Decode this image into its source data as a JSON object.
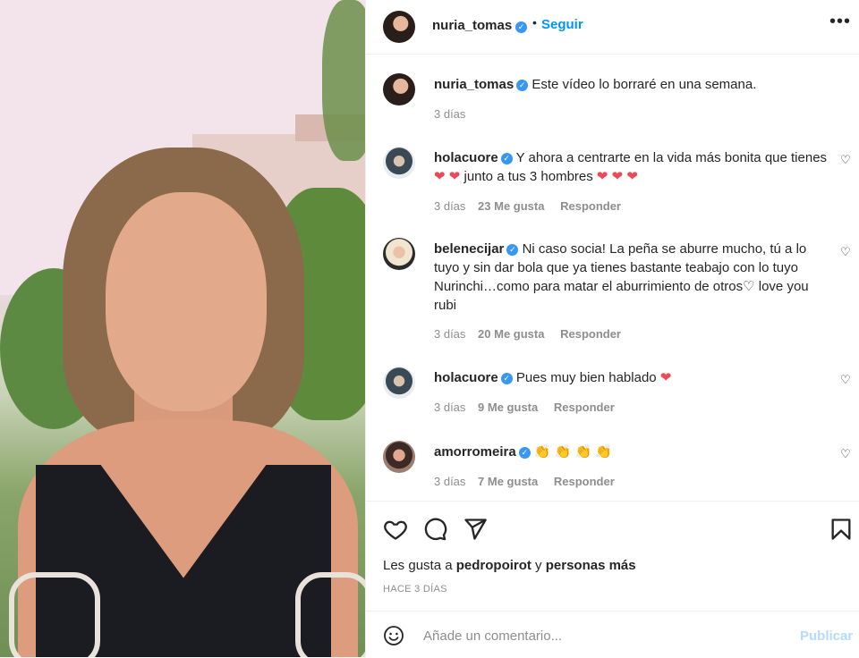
{
  "header": {
    "username": "nuria_tomas",
    "separator": "•",
    "follow_label": "Seguir",
    "more_icon": "more-icon"
  },
  "caption": {
    "username": "nuria_tomas",
    "text": "Este vídeo lo borraré en una semana.",
    "time": "3 días"
  },
  "comments": [
    {
      "username": "holacuore",
      "text": "Y ahora a centrarte en la vida más bonita que tienes ❤️ ❤️ junto a tus 3 hombres ❤️ ❤️ ❤️",
      "time": "3 días",
      "likes": "23 Me gusta",
      "reply": "Responder"
    },
    {
      "username": "belenecijar",
      "text": "Ni caso socia! La peña se aburre mucho, tú a lo tuyo y sin dar bola que ya tienes bastante teabajo con lo tuyo Nurinchi…como para matar el aburrimiento de otros♡ love you rubi",
      "time": "3 días",
      "likes": "20 Me gusta",
      "reply": "Responder"
    },
    {
      "username": "holacuore",
      "text": "Pues muy bien hablado ❤️",
      "time": "3 días",
      "likes": "9 Me gusta",
      "reply": "Responder"
    },
    {
      "username": "amorromeira",
      "text": "👏 👏 👏 👏",
      "time": "3 días",
      "likes": "7 Me gusta",
      "reply": "Responder"
    }
  ],
  "likes": {
    "prefix": "Les gusta a ",
    "user": "pedropoirot",
    "middle": " y ",
    "others": "personas más"
  },
  "timestamp": "HACE 3 DÍAS",
  "add_comment": {
    "placeholder": "Añade un comentario...",
    "publish_label": "Publicar"
  },
  "colors": {
    "accent": "#0095f6",
    "verified": "#3897f0",
    "heart_red": "#ed4956",
    "muted": "#8e8e8e",
    "publish_disabled": "#b3dbff"
  }
}
